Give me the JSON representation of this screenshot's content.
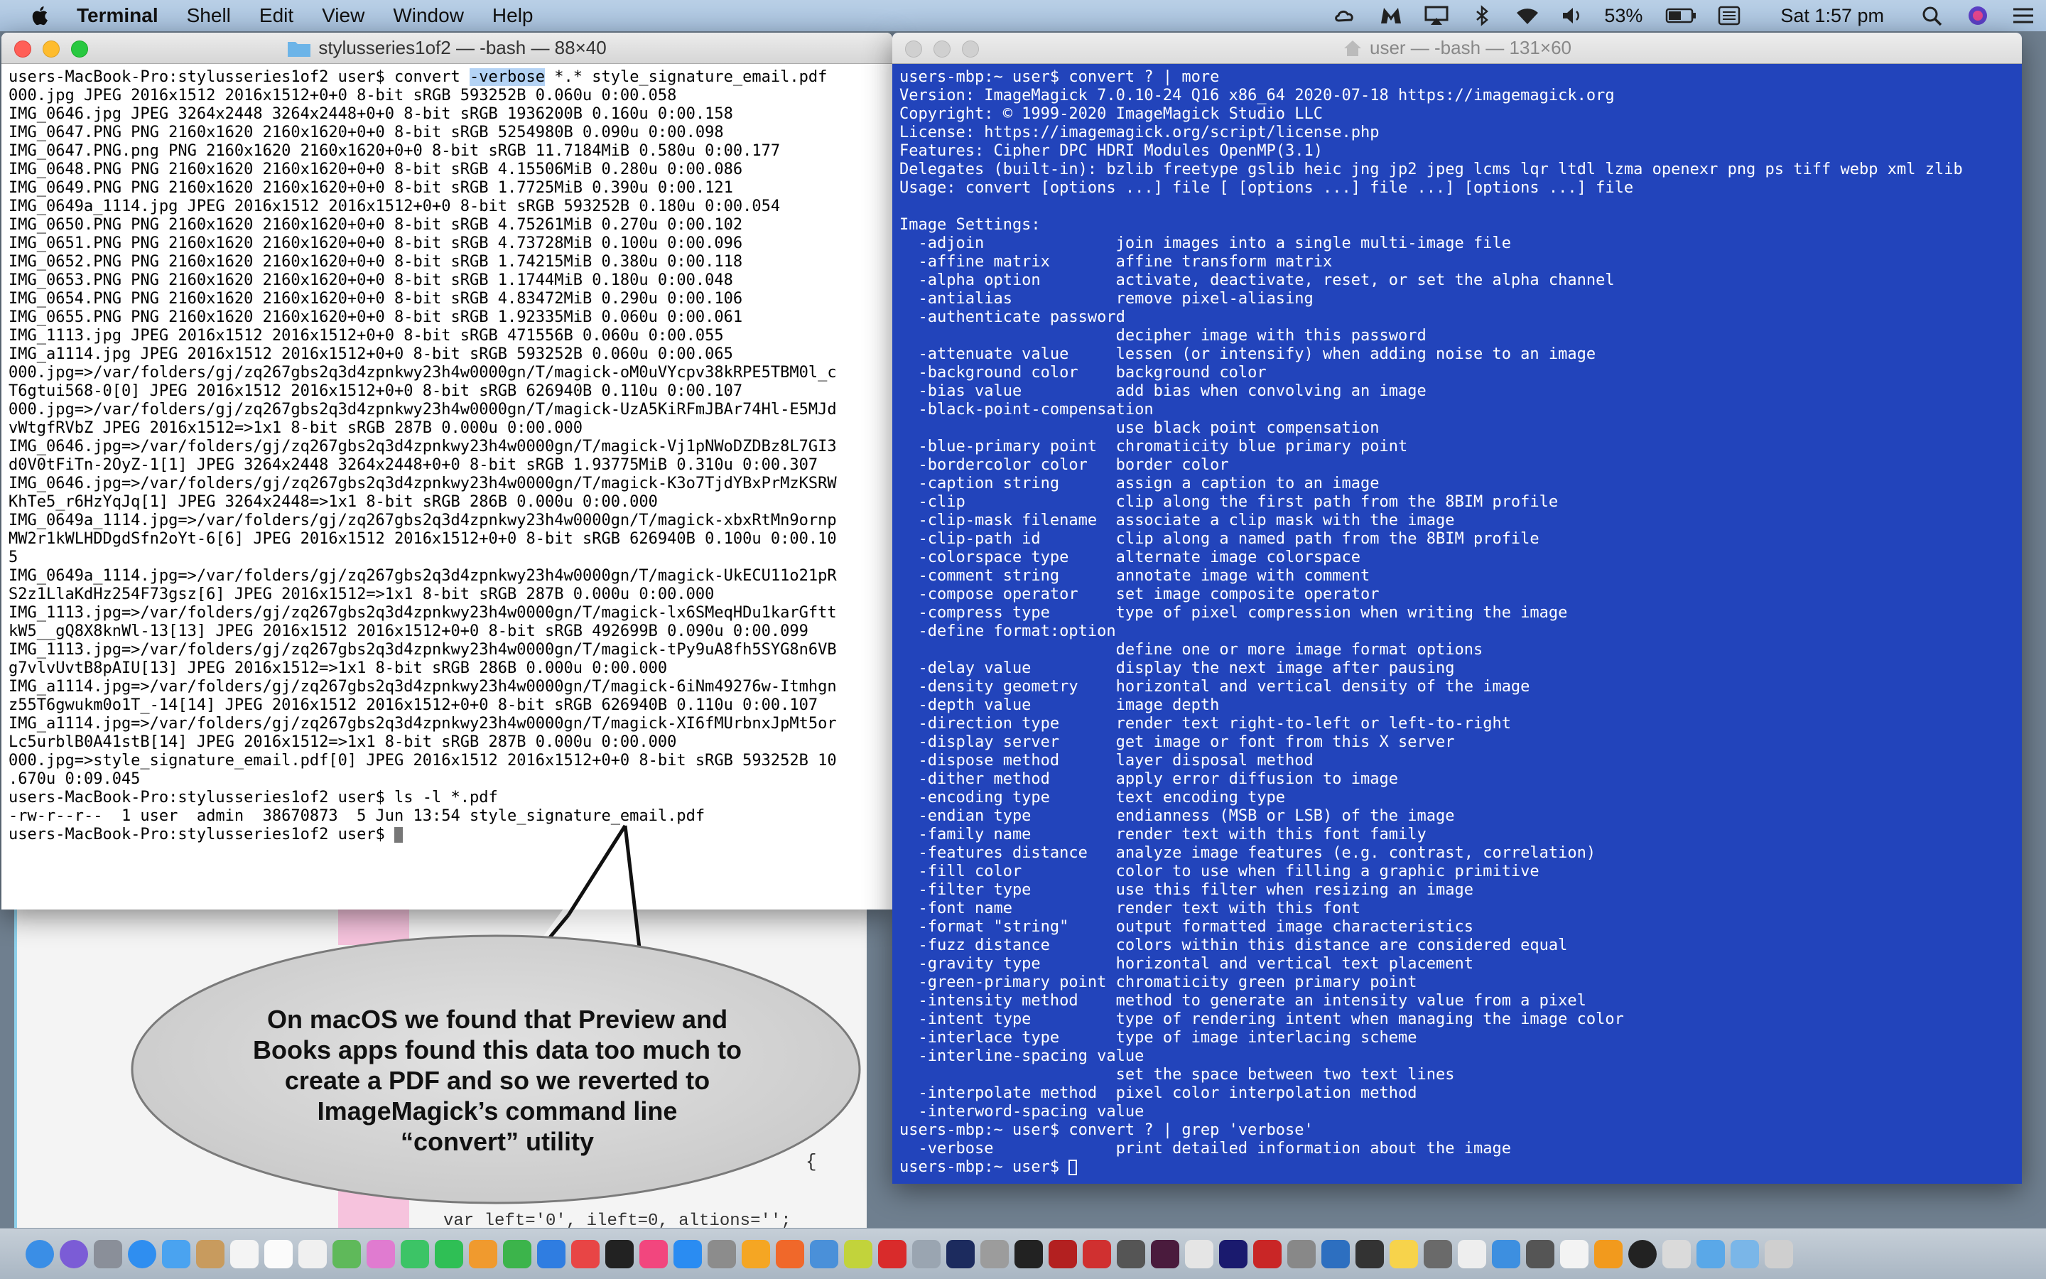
{
  "menubar": {
    "app_name": "Terminal",
    "menus": [
      "Shell",
      "Edit",
      "View",
      "Window",
      "Help"
    ],
    "battery": "53%",
    "clock": "Sat 1:57 pm",
    "status_icons": [
      "creative-cloud-icon",
      "malwarebytes-icon",
      "airplay-icon",
      "bluetooth-icon",
      "wifi-icon",
      "volume-icon",
      "battery-icon",
      "keyboard-input-icon",
      "spotlight-icon",
      "siri-icon",
      "notification-center-icon"
    ]
  },
  "left_terminal": {
    "title": "stylusseries1of2 — -bash — 88×40",
    "command_prefix": "users-MacBook-Pro:stylusseries1of2 user$ convert ",
    "command_flag": "-verbose",
    "command_suffix": " *.* style_signature_email.pdf",
    "output": "000.jpg JPEG 2016x1512 2016x1512+0+0 8-bit sRGB 593252B 0.060u 0:00.058\nIMG_0646.jpg JPEG 3264x2448 3264x2448+0+0 8-bit sRGB 1936200B 0.160u 0:00.158\nIMG_0647.PNG PNG 2160x1620 2160x1620+0+0 8-bit sRGB 5254980B 0.090u 0:00.098\nIMG_0647.PNG.png PNG 2160x1620 2160x1620+0+0 8-bit sRGB 11.7184MiB 0.580u 0:00.177\nIMG_0648.PNG PNG 2160x1620 2160x1620+0+0 8-bit sRGB 4.15506MiB 0.280u 0:00.086\nIMG_0649.PNG PNG 2160x1620 2160x1620+0+0 8-bit sRGB 1.7725MiB 0.390u 0:00.121\nIMG_0649a_1114.jpg JPEG 2016x1512 2016x1512+0+0 8-bit sRGB 593252B 0.180u 0:00.054\nIMG_0650.PNG PNG 2160x1620 2160x1620+0+0 8-bit sRGB 4.75261MiB 0.270u 0:00.102\nIMG_0651.PNG PNG 2160x1620 2160x1620+0+0 8-bit sRGB 4.73728MiB 0.100u 0:00.096\nIMG_0652.PNG PNG 2160x1620 2160x1620+0+0 8-bit sRGB 1.74215MiB 0.380u 0:00.118\nIMG_0653.PNG PNG 2160x1620 2160x1620+0+0 8-bit sRGB 1.1744MiB 0.180u 0:00.048\nIMG_0654.PNG PNG 2160x1620 2160x1620+0+0 8-bit sRGB 4.83472MiB 0.290u 0:00.106\nIMG_0655.PNG PNG 2160x1620 2160x1620+0+0 8-bit sRGB 1.92335MiB 0.060u 0:00.061\nIMG_1113.jpg JPEG 2016x1512 2016x1512+0+0 8-bit sRGB 471556B 0.060u 0:00.055\nIMG_a1114.jpg JPEG 2016x1512 2016x1512+0+0 8-bit sRGB 593252B 0.060u 0:00.065\n000.jpg=>/var/folders/gj/zq267gbs2q3d4zpnkwy23h4w0000gn/T/magick-oM0uVYcpv38kRPE5TBM0l_c\nT6gtui568-0[0] JPEG 2016x1512 2016x1512+0+0 8-bit sRGB 626940B 0.110u 0:00.107\n000.jpg=>/var/folders/gj/zq267gbs2q3d4zpnkwy23h4w0000gn/T/magick-UzA5KiRFmJBAr74Hl-E5MJd\nvWtgfRVbZ JPEG 2016x1512=>1x1 8-bit sRGB 287B 0.000u 0:00.000\nIMG_0646.jpg=>/var/folders/gj/zq267gbs2q3d4zpnkwy23h4w0000gn/T/magick-Vj1pNWoDZDBz8L7GI3\nd0V0tFiTn-2OyZ-1[1] JPEG 3264x2448 3264x2448+0+0 8-bit sRGB 1.93775MiB 0.310u 0:00.307\nIMG_0646.jpg=>/var/folders/gj/zq267gbs2q3d4zpnkwy23h4w0000gn/T/magick-K3o7TjdYBxPrMzKSRW\nKhTe5_r6HzYqJq[1] JPEG 3264x2448=>1x1 8-bit sRGB 286B 0.000u 0:00.000\nIMG_0649a_1114.jpg=>/var/folders/gj/zq267gbs2q3d4zpnkwy23h4w0000gn/T/magick-xbxRtMn9ornp\nMW2r1kWLHDDgdSfn2oYt-6[6] JPEG 2016x1512 2016x1512+0+0 8-bit sRGB 626940B 0.100u 0:00.10\n5\nIMG_0649a_1114.jpg=>/var/folders/gj/zq267gbs2q3d4zpnkwy23h4w0000gn/T/magick-UkECU11o21pR\nS2z1LlaKdHz254F73gsz[6] JPEG 2016x1512=>1x1 8-bit sRGB 287B 0.000u 0:00.000\nIMG_1113.jpg=>/var/folders/gj/zq267gbs2q3d4zpnkwy23h4w0000gn/T/magick-lx6SMeqHDu1karGftt\nkW5__gQ8X8knWl-13[13] JPEG 2016x1512 2016x1512+0+0 8-bit sRGB 492699B 0.090u 0:00.099\nIMG_1113.jpg=>/var/folders/gj/zq267gbs2q3d4zpnkwy23h4w0000gn/T/magick-tPy9uA8fh5SYG8n6VB\ng7vlvUvtB8pAIU[13] JPEG 2016x1512=>1x1 8-bit sRGB 286B 0.000u 0:00.000\nIMG_a1114.jpg=>/var/folders/gj/zq267gbs2q3d4zpnkwy23h4w0000gn/T/magick-6iNm49276w-Itmhgn\nz55T6gwukm0o1T_-14[14] JPEG 2016x1512 2016x1512+0+0 8-bit sRGB 626940B 0.110u 0:00.107\nIMG_a1114.jpg=>/var/folders/gj/zq267gbs2q3d4zpnkwy23h4w0000gn/T/magick-XI6fMUrbnxJpMt5or\nLc5urblB0A41stB[14] JPEG 2016x1512=>1x1 8-bit sRGB 287B 0.000u 0:00.000\n000.jpg=>style_signature_email.pdf[0] JPEG 2016x1512 2016x1512+0+0 8-bit sRGB 593252B 10\n.670u 0:09.045\nusers-MacBook-Pro:stylusseries1of2 user$ ls -l *.pdf\n-rw-r--r--  1 user  admin  38670873  5 Jun 13:54 style_signature_email.pdf",
    "prompt": "users-MacBook-Pro:stylusseries1of2 user$ "
  },
  "right_terminal": {
    "title": "user — -bash — 131×60",
    "output": "users-mbp:~ user$ convert ? | more\nVersion: ImageMagick 7.0.10-24 Q16 x86_64 2020-07-18 https://imagemagick.org\nCopyright: © 1999-2020 ImageMagick Studio LLC\nLicense: https://imagemagick.org/script/license.php\nFeatures: Cipher DPC HDRI Modules OpenMP(3.1)\nDelegates (built-in): bzlib freetype gslib heic jng jp2 jpeg lcms lqr ltdl lzma openexr png ps tiff webp xml zlib\nUsage: convert [options ...] file [ [options ...] file ...] [options ...] file\n\nImage Settings:\n  -adjoin              join images into a single multi-image file\n  -affine matrix       affine transform matrix\n  -alpha option        activate, deactivate, reset, or set the alpha channel\n  -antialias           remove pixel-aliasing\n  -authenticate password\n                       decipher image with this password\n  -attenuate value     lessen (or intensify) when adding noise to an image\n  -background color    background color\n  -bias value          add bias when convolving an image\n  -black-point-compensation\n                       use black point compensation\n  -blue-primary point  chromaticity blue primary point\n  -bordercolor color   border color\n  -caption string      assign a caption to an image\n  -clip                clip along the first path from the 8BIM profile\n  -clip-mask filename  associate a clip mask with the image\n  -clip-path id        clip along a named path from the 8BIM profile\n  -colorspace type     alternate image colorspace\n  -comment string      annotate image with comment\n  -compose operator    set image composite operator\n  -compress type       type of pixel compression when writing the image\n  -define format:option\n                       define one or more image format options\n  -delay value         display the next image after pausing\n  -density geometry    horizontal and vertical density of the image\n  -depth value         image depth\n  -direction type      render text right-to-left or left-to-right\n  -display server      get image or font from this X server\n  -dispose method      layer disposal method\n  -dither method       apply error diffusion to image\n  -encoding type       text encoding type\n  -endian type         endianness (MSB or LSB) of the image\n  -family name         render text with this font family\n  -features distance   analyze image features (e.g. contrast, correlation)\n  -fill color          color to use when filling a graphic primitive\n  -filter type         use this filter when resizing an image\n  -font name           render text with this font\n  -format \"string\"     output formatted image characteristics\n  -fuzz distance       colors within this distance are considered equal\n  -gravity type        horizontal and vertical text placement\n  -green-primary point chromaticity green primary point\n  -intensity method    method to generate an intensity value from a pixel\n  -intent type         type of rendering intent when managing the image color\n  -interlace type      type of image interlacing scheme\n  -interline-spacing value\n                       set the space between two text lines\n  -interpolate method  pixel color interpolation method\n  -interword-spacing value\nusers-mbp:~ user$ convert ? | grep 'verbose'\n  -verbose             print detailed information about the image",
    "prompt": "users-mbp:~ user$ "
  },
  "callout": {
    "lines": [
      "On macOS we found that Preview and",
      "Books apps found this data too much to",
      "create a PDF and so we reverted to",
      "ImageMagick’s command line",
      "“convert” utility"
    ]
  },
  "background_window": {
    "code_fragment": "var left='0', ileft=0, altions='';",
    "brace": "{"
  },
  "colors": {
    "right_terminal_bg": "#2244bb",
    "left_terminal_bg": "#ffffff",
    "selection": "#b4d3f5",
    "callout_fill": "#d5d5d5"
  },
  "dock": {
    "icons": [
      "finder-icon",
      "siri-icon",
      "launchpad-icon",
      "safari-icon",
      "mail-icon",
      "contacts-icon",
      "calendar-icon",
      "notes-icon",
      "reminders-icon",
      "maps-icon",
      "photos-icon",
      "messages-icon",
      "facetime-icon",
      "pages-icon",
      "numbers-icon",
      "keynote-icon",
      "news-icon",
      "stocks-icon",
      "music-icon",
      "app-store-icon",
      "system-preferences-icon",
      "amazon-icon",
      "firefox-icon",
      "chrome-icon",
      "wordpress-icon",
      "opera-icon",
      "elephant-icon",
      "photoshop-icon",
      "script-editor-icon",
      "terminal-icon",
      "filezilla-icon",
      "pdf-icon",
      "activity-icon",
      "xd-icon",
      "pinwheel-icon",
      "folder-f-icon",
      "filezilla2-icon",
      "automator-icon",
      "thunderbird-icon",
      "font-icon",
      "sketch-icon",
      "utility-icon",
      "text-edit-icon",
      "xcode-icon",
      "script-icon",
      "document-icon",
      "books-icon",
      "circle-icon",
      "documents-icon",
      "folder-icon",
      "download-icon",
      "trash-icon"
    ]
  }
}
